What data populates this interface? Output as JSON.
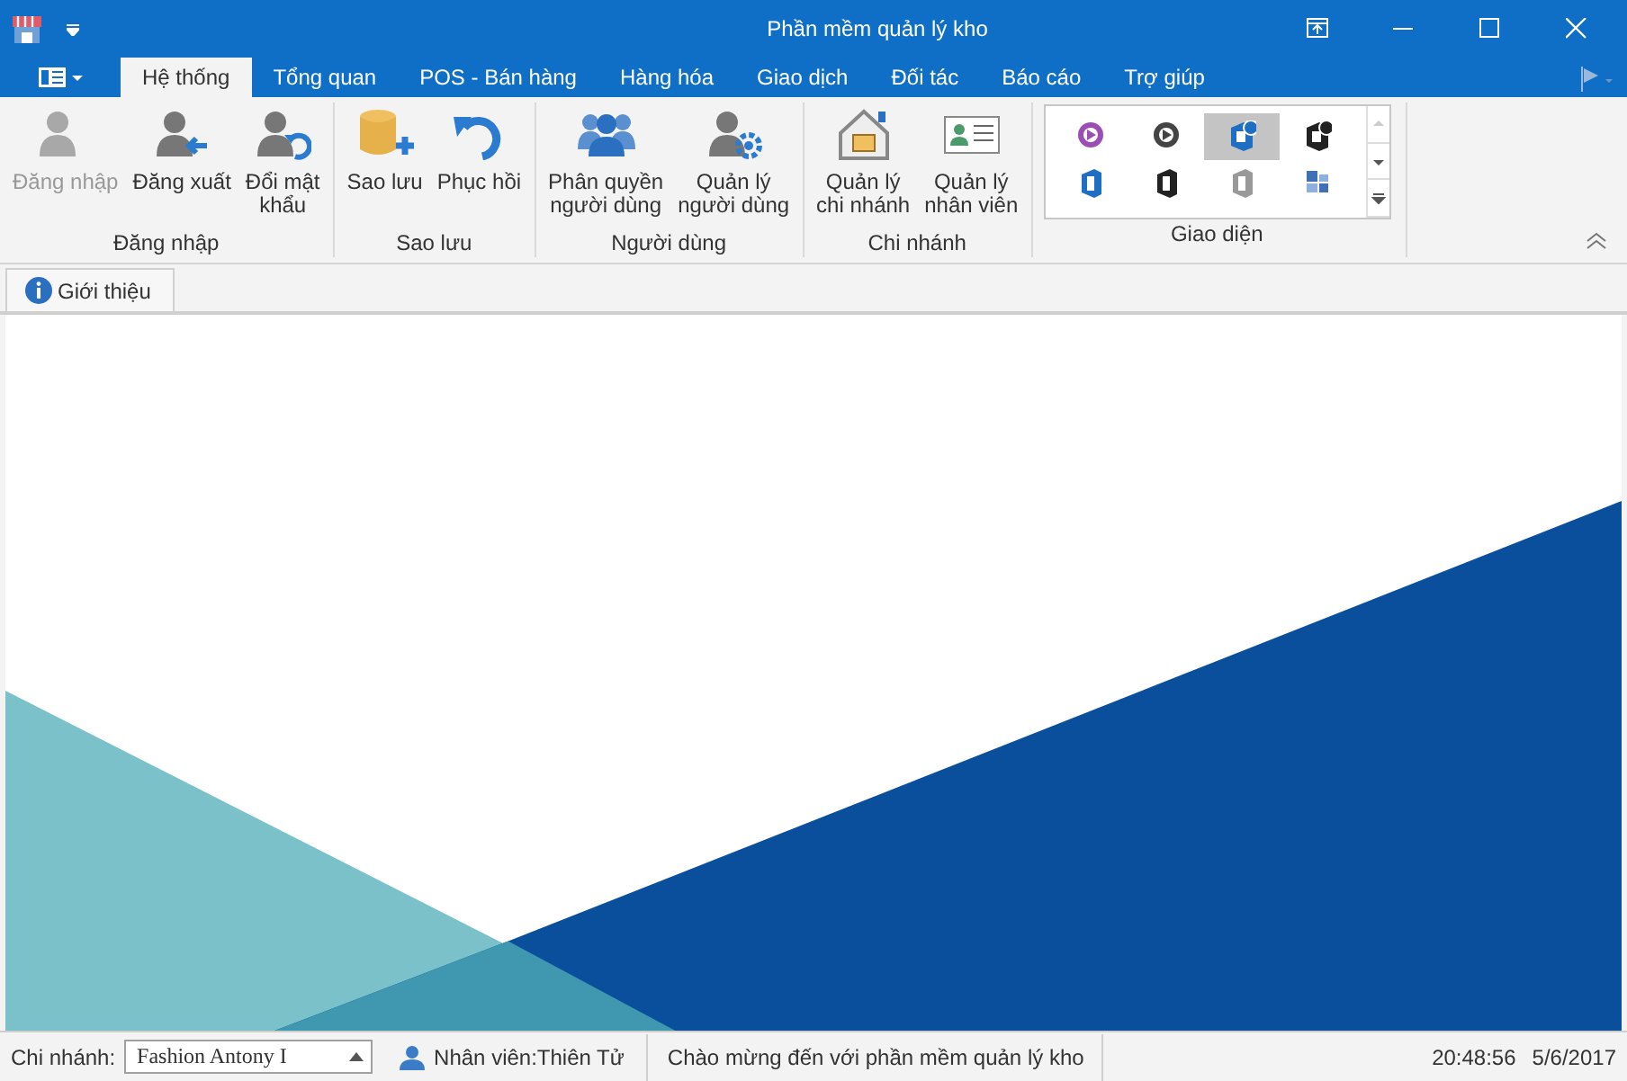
{
  "window": {
    "title": "Phần mềm quản lý kho"
  },
  "ribbon_tabs": [
    {
      "label": "Hệ thống",
      "selected": true
    },
    {
      "label": "Tổng quan",
      "selected": false
    },
    {
      "label": "POS - Bán hàng",
      "selected": false
    },
    {
      "label": "Hàng hóa",
      "selected": false
    },
    {
      "label": "Giao dịch",
      "selected": false
    },
    {
      "label": "Đối tác",
      "selected": false
    },
    {
      "label": "Báo cáo",
      "selected": false
    },
    {
      "label": "Trợ giúp",
      "selected": false
    }
  ],
  "ribbon_groups": [
    {
      "title": "Đăng nhập",
      "buttons": [
        {
          "label": "Đăng nhập",
          "disabled": true
        },
        {
          "label": "Đăng xuất",
          "disabled": false
        },
        {
          "label": "Đổi mật\nkhẩu",
          "disabled": false
        }
      ]
    },
    {
      "title": "Sao lưu",
      "buttons": [
        {
          "label": "Sao lưu",
          "disabled": false
        },
        {
          "label": "Phục hồi",
          "disabled": false
        }
      ]
    },
    {
      "title": "Người dùng",
      "buttons": [
        {
          "label": "Phân quyền\nngười dùng",
          "disabled": false
        },
        {
          "label": "Quản lý\nngười dùng",
          "disabled": false
        }
      ]
    },
    {
      "title": "Chi nhánh",
      "buttons": [
        {
          "label": "Quản lý\nchi nhánh",
          "disabled": false
        },
        {
          "label": "Quản lý\nnhân viên",
          "disabled": false
        }
      ]
    }
  ],
  "theme_gallery": {
    "title": "Giao diện",
    "items": [
      {
        "kind": "circle",
        "color": "#9b4fb5",
        "selected": false
      },
      {
        "kind": "circle",
        "color": "#444444",
        "selected": false
      },
      {
        "kind": "office16",
        "color": "#1e6fc4",
        "selected": true
      },
      {
        "kind": "office16",
        "color": "#222222",
        "selected": false
      },
      {
        "kind": "office",
        "color": "#1e6fc4",
        "selected": false
      },
      {
        "kind": "office",
        "color": "#222222",
        "selected": false
      },
      {
        "kind": "office",
        "color": "#999999",
        "selected": false
      },
      {
        "kind": "tiles",
        "color": "#3f6fb5",
        "selected": false
      }
    ]
  },
  "doc_tabs": [
    {
      "label": "Giới thiệu",
      "selected": true
    }
  ],
  "status_bar": {
    "branch_label": "Chi nhánh:",
    "branch_value": "Fashion Antony I",
    "employee": "Nhân viên:Thiên Tử",
    "message": "Chào mừng đến với phần mềm quản lý kho",
    "time": "20:48:56",
    "date": "5/6/2017"
  }
}
